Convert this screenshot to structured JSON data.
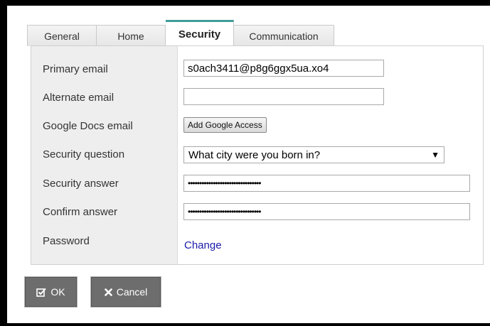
{
  "tabs": [
    {
      "label": "General"
    },
    {
      "label": "Home"
    },
    {
      "label": "Security"
    },
    {
      "label": "Communication"
    }
  ],
  "active_tab": "Security",
  "form": {
    "primary_email": {
      "label": "Primary email",
      "value": "s0ach3411@p8g6ggx5ua.xo4"
    },
    "alternate_email": {
      "label": "Alternate email",
      "value": ""
    },
    "google_docs_email": {
      "label": "Google Docs email",
      "button_label": "Add Google Access"
    },
    "security_question": {
      "label": "Security question",
      "selected": "What city were you born in?"
    },
    "security_answer": {
      "label": "Security answer",
      "masked": "••••••••••••••••••••••••••••••••"
    },
    "confirm_answer": {
      "label": "Confirm answer",
      "masked": "••••••••••••••••••••••••••••••••"
    },
    "password": {
      "label": "Password",
      "link_label": "Change"
    }
  },
  "buttons": {
    "ok_label": "OK",
    "cancel_label": "Cancel"
  },
  "icons": {
    "ok": "checkbox-check-icon",
    "cancel": "x-icon",
    "dropdown": "caret-down-icon"
  },
  "colors": {
    "active_tab_accent": "#3f9c9a",
    "button_bg": "#6d6d6d",
    "link": "#1a1aaa",
    "label_column_bg": "#eeeeee"
  }
}
